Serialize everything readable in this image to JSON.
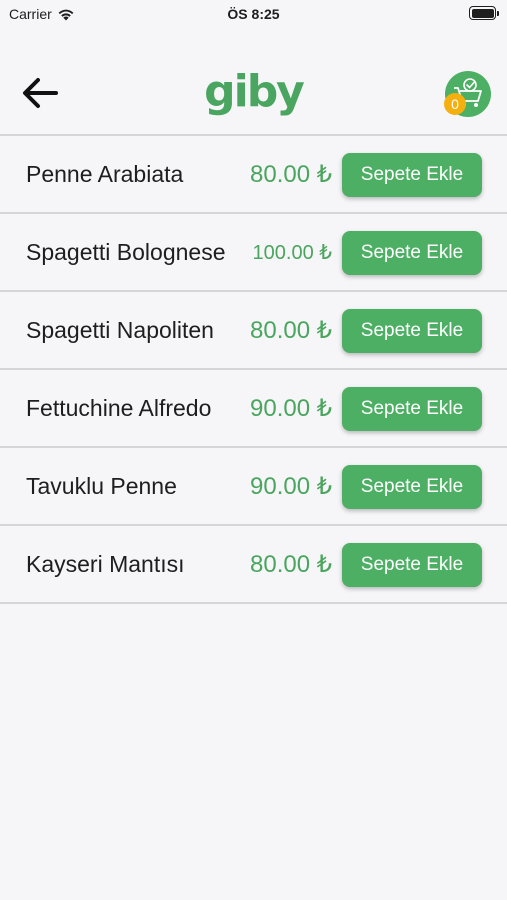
{
  "status_bar": {
    "carrier": "Carrier",
    "time": "ÖS 8:25"
  },
  "header": {
    "logo": "giby",
    "cart_count": "0"
  },
  "icons": {
    "back": "arrow-left-icon",
    "cart": "shopping-cart-check-icon",
    "wifi": "wifi-icon",
    "battery": "battery-icon"
  },
  "colors": {
    "accent": "#4caf63",
    "price": "#4aa55e",
    "badge": "#f4b00f",
    "background": "#f6f5f7"
  },
  "products": [
    {
      "name": "Penne Arabiata",
      "price": "80.00 ₺",
      "button": "Sepete Ekle"
    },
    {
      "name": "Spagetti Bolognese",
      "price": "100.00 ₺",
      "button": "Sepete Ekle"
    },
    {
      "name": "Spagetti Napoliten",
      "price": "80.00 ₺",
      "button": "Sepete Ekle"
    },
    {
      "name": "Fettuchine Alfredo",
      "price": "90.00 ₺",
      "button": "Sepete Ekle"
    },
    {
      "name": "Tavuklu Penne",
      "price": "90.00 ₺",
      "button": "Sepete Ekle"
    },
    {
      "name": "Kayseri Mantısı",
      "price": "80.00 ₺",
      "button": "Sepete Ekle"
    }
  ]
}
